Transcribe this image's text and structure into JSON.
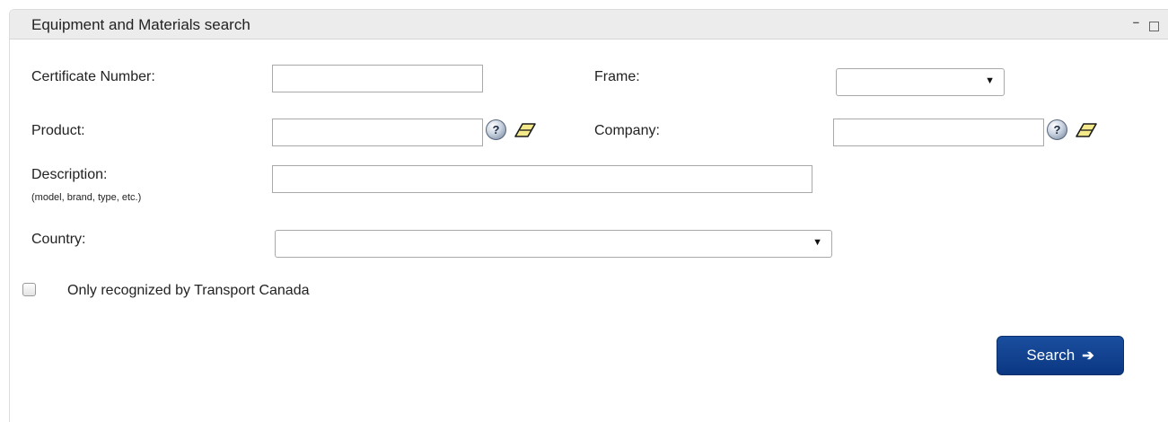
{
  "panel": {
    "title": "Equipment and Materials search",
    "minimize_glyph": "–",
    "maximize_glyph": ""
  },
  "form": {
    "certificate_number": {
      "label": "Certificate Number:",
      "value": ""
    },
    "frame": {
      "label": "Frame:",
      "selected": ""
    },
    "product": {
      "label": "Product:",
      "value": ""
    },
    "company": {
      "label": "Company:",
      "value": ""
    },
    "description": {
      "label": "Description:",
      "hint": "(model, brand, type, etc.)",
      "value": ""
    },
    "country": {
      "label": "Country:",
      "selected": ""
    },
    "help_glyph": "?",
    "dropdown_arrow": "▼",
    "recognized_checkbox": {
      "label": "Only recognized by Transport Canada",
      "checked": false
    }
  },
  "actions": {
    "search_label": "Search",
    "search_arrow": "➔"
  },
  "icons": {
    "help": "question-circle-icon",
    "eraser": "eraser-icon",
    "arrow": "arrow-right-icon"
  },
  "colors": {
    "header_bg": "#ececec",
    "button_bg": "#0b3782",
    "eraser_fill": "#f4e98a"
  }
}
